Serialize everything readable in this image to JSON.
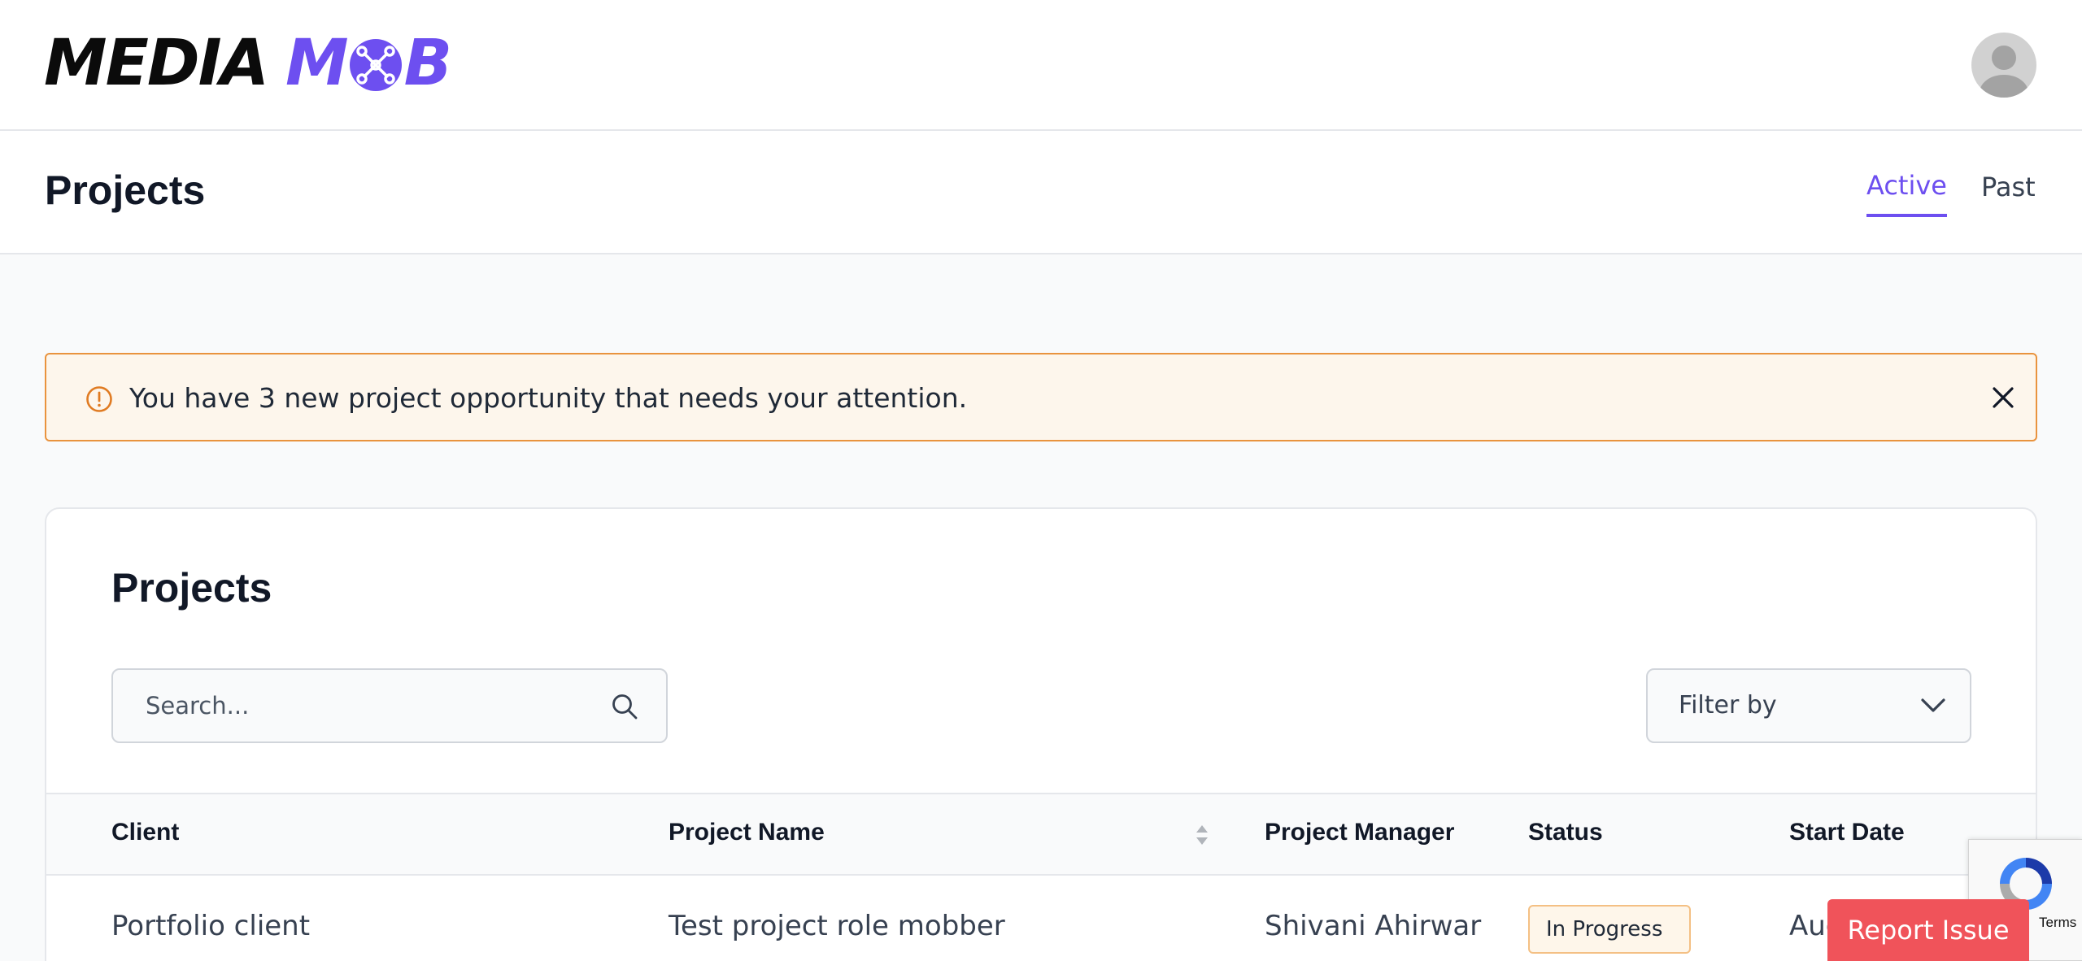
{
  "header": {
    "logo_word1": "MEDIA",
    "logo_word2_left": "M",
    "logo_word2_right": "B",
    "brand_color": "#6d4ff0"
  },
  "titlebar": {
    "title": "Projects",
    "tabs": [
      {
        "label": "Active",
        "active": true
      },
      {
        "label": "Past",
        "active": false
      }
    ]
  },
  "alert": {
    "icon": "exclamation-circle-icon",
    "message": "You have 3 new project opportunity that needs your attention.",
    "border_color": "#e9933e",
    "background": "#fdf6ec"
  },
  "projects_card": {
    "title": "Projects",
    "search": {
      "placeholder": "Search...",
      "value": ""
    },
    "filter": {
      "label": "Filter by"
    },
    "columns": [
      "Client",
      "Project Name",
      "Project Manager",
      "Status",
      "Start Date"
    ],
    "rows": [
      {
        "client": "Portfolio client",
        "project_name": "Test project role mobber",
        "project_manager": "Shivani Ahirwar",
        "status": "In Progress",
        "start_date": "Aug"
      }
    ]
  },
  "recaptcha": {
    "terms": "Terms"
  },
  "report_issue": {
    "label": "Report Issue",
    "color": "#f0535a"
  }
}
